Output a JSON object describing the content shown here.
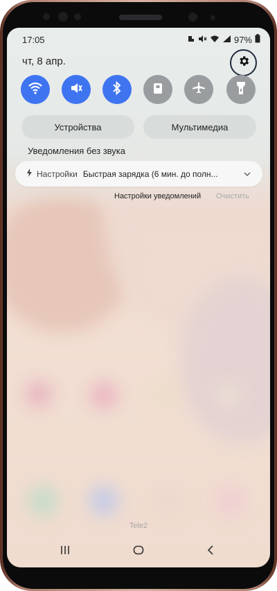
{
  "status_bar": {
    "time": "17:05",
    "battery": "97%",
    "icons": [
      "notification-icon",
      "mute-icon",
      "wifi-icon",
      "signal-icon",
      "battery-icon"
    ]
  },
  "header": {
    "date": "чт, 8 апр.",
    "settings_icon": "gear-icon"
  },
  "quick_toggles": [
    {
      "icon": "wifi-icon",
      "state": "on"
    },
    {
      "icon": "mute-icon",
      "state": "on"
    },
    {
      "icon": "bluetooth-icon",
      "state": "on"
    },
    {
      "icon": "lock-rotation-icon",
      "state": "off"
    },
    {
      "icon": "airplane-icon",
      "state": "off"
    },
    {
      "icon": "flashlight-icon",
      "state": "off"
    }
  ],
  "panel_buttons": {
    "devices": "Устройства",
    "media": "Мультимедиа"
  },
  "silent_section": {
    "title": "Уведомления без звука"
  },
  "notification": {
    "app": "Настройки",
    "text": "Быстрая зарядка (6 мин. до полн...",
    "icon": "bolt-icon"
  },
  "notification_actions": {
    "settings": "Настройки уведомлений",
    "clear": "Очистить"
  },
  "carrier": "Tele2",
  "nav": {
    "recents": "recents-icon",
    "home": "home-icon",
    "back": "back-icon"
  },
  "colors": {
    "toggle_on": "#3f74f1",
    "toggle_off": "#9a9d9f",
    "accent_ring": "#1f2b3c"
  }
}
